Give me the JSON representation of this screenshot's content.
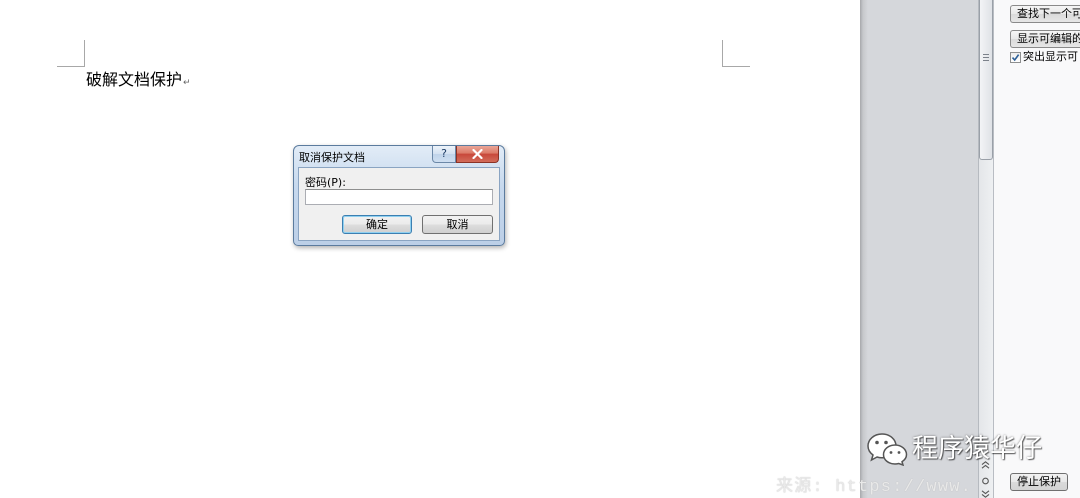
{
  "document": {
    "text": "破解文档保护",
    "paragraph_mark": "↵"
  },
  "dialog": {
    "title": "取消保护文档",
    "help_glyph": "?",
    "password_label": "密码(P):",
    "password_value": "",
    "ok_label": "确定",
    "cancel_label": "取消"
  },
  "task_pane": {
    "find_next_label": "查找下一个可",
    "show_all_label": "显示可编辑的",
    "highlight_label": "突出显示可",
    "highlight_checked": true,
    "stop_protection_label": "停止保护"
  },
  "watermark": {
    "brand_text": "程序猿华仔",
    "source_text": "来源: https://www."
  },
  "icons": {
    "help": "help-icon",
    "close": "close-icon",
    "paragraph_mark": "paragraph-mark-icon",
    "scroll_grip": "grip-icon",
    "prev_page": "previous-page-icon",
    "browse_object": "select-browse-object-icon",
    "next_page": "next-page-icon",
    "checkbox_check": "checkmark-icon",
    "wechat": "wechat-icon"
  },
  "colors": {
    "close_button": "#c8473a",
    "default_button_border": "#3c7fb1",
    "dialog_frame": "#c7d9ee",
    "workspace_gray": "#d5d7db",
    "watermark_text": "#ffffff"
  }
}
